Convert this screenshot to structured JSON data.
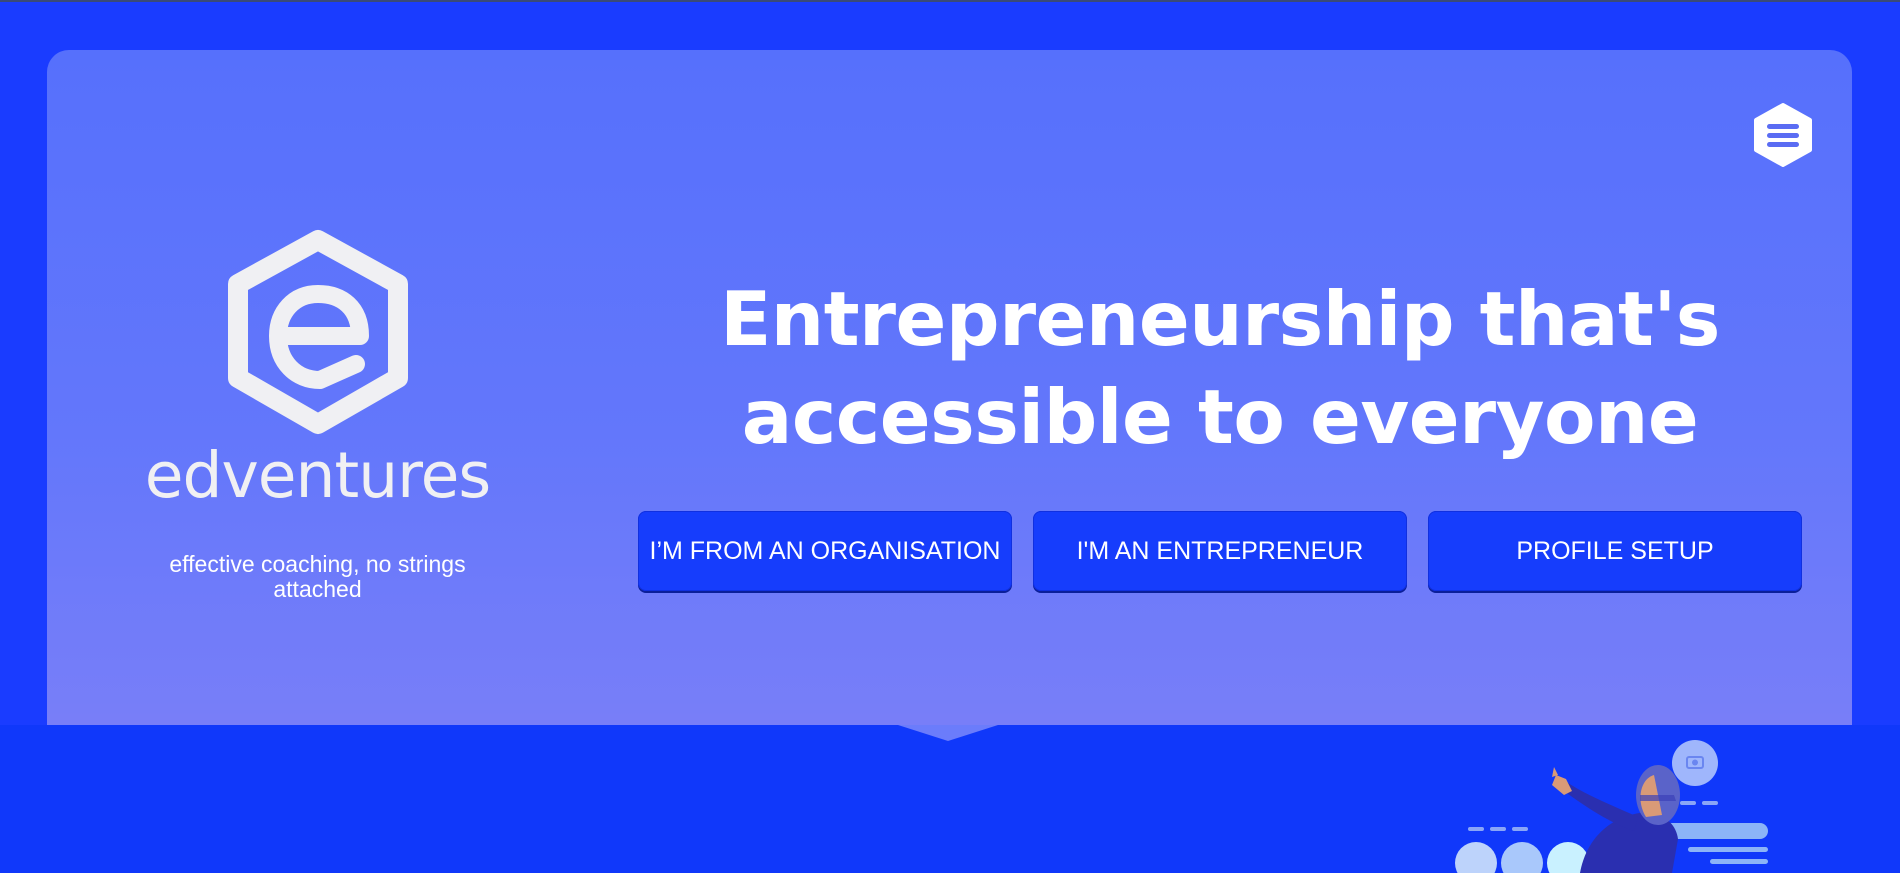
{
  "brand": {
    "name": "edventures",
    "tagline": "effective coaching, no strings attached",
    "logo_icon": "edventures-hexagon-e-logo"
  },
  "header": {
    "menu_icon": "hamburger-menu-icon"
  },
  "hero": {
    "headline": "Entrepreneurship that's accessible to everyone",
    "buttons": {
      "organisation": "I’M FROM AN ORGANISATION",
      "entrepreneur": "I'M AN ENTREPRENEUR",
      "profile": "PROFILE SETUP"
    }
  },
  "colors": {
    "page_background": "#1a3cff",
    "card_gradient_top": "#5670fc",
    "card_gradient_bottom": "#7a7ff8",
    "button_background": "#163dfc",
    "text": "#ffffff"
  }
}
